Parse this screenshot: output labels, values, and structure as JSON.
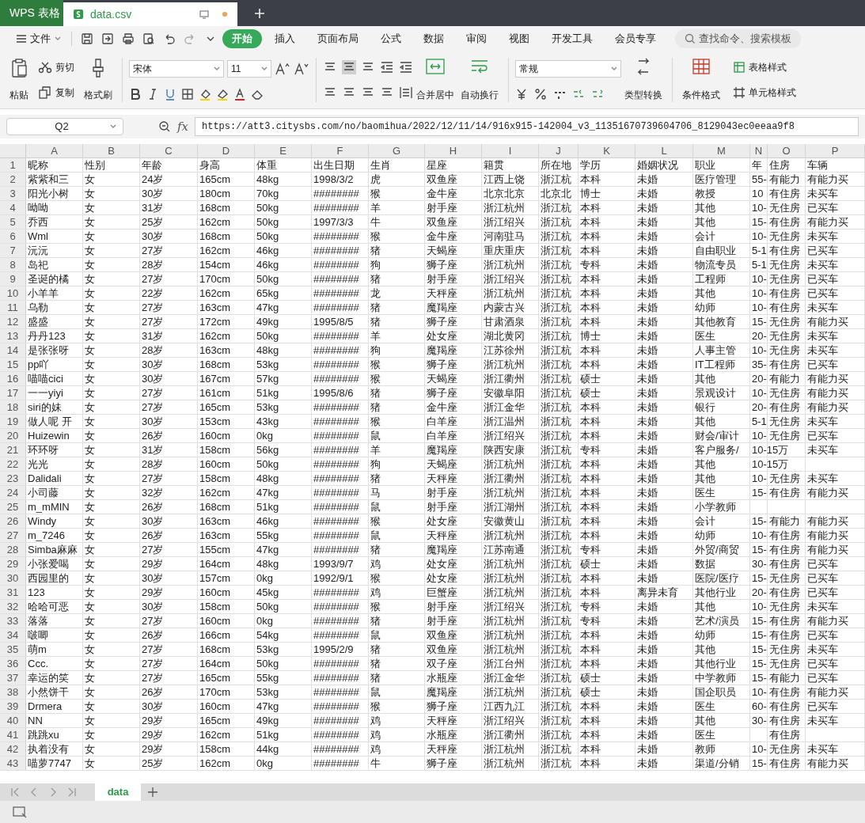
{
  "title_bar": {
    "tabs": [
      {
        "label": "WPS 表格",
        "kind": "app",
        "selected": false
      },
      {
        "label": "data.csv",
        "kind": "file",
        "selected": true
      }
    ]
  },
  "menu": {
    "file": "文件",
    "tabs": [
      {
        "label": "开始",
        "selected": true
      },
      {
        "label": "插入",
        "selected": false
      },
      {
        "label": "页面布局",
        "selected": false
      },
      {
        "label": "公式",
        "selected": false
      },
      {
        "label": "数据",
        "selected": false
      },
      {
        "label": "审阅",
        "selected": false
      },
      {
        "label": "视图",
        "selected": false
      },
      {
        "label": "开发工具",
        "selected": false
      },
      {
        "label": "会员专享",
        "selected": false
      }
    ],
    "search_placeholder": "查找命令、搜索模板"
  },
  "ribbon": {
    "paste": "粘贴",
    "cut": "剪切",
    "copy": "复制",
    "format_painter": "格式刷",
    "font": "宋体",
    "font_size": "11",
    "merge": "合并居中",
    "wrap": "自动换行",
    "number_format": "常规",
    "convert": "类型转换",
    "conditional": "条件格式",
    "table_style": "表格样式",
    "cell_style": "单元格样式"
  },
  "formula_bar": {
    "cell": "Q2",
    "function_label": "fx",
    "formula": "https://att3.citysbs.com/no/baomihua/2022/12/11/14/916x915-142004_v3_11351670739604706_8129043ec0eeaa9f8"
  },
  "sheet": {
    "columns": [
      "A",
      "B",
      "C",
      "D",
      "E",
      "F",
      "G",
      "H",
      "I",
      "J",
      "K",
      "L",
      "M",
      "N",
      "O",
      "P"
    ],
    "rows": [
      {
        "number": "1",
        "cells": [
          "昵称",
          "性别",
          "年龄",
          "身高",
          "体重",
          "出生日期",
          "生肖",
          "星座",
          "籍贯",
          "所在地",
          "学历",
          "婚姻状况",
          "职业",
          "年",
          "住房",
          "车辆"
        ]
      },
      {
        "number": "2",
        "cells": [
          "紫紫和三",
          "女",
          "24岁",
          "165cm",
          "48kg",
          "1998/3/2",
          "虎",
          "双鱼座",
          "江西上饶",
          "浙江杭",
          "本科",
          "未婚",
          "医疗管理",
          "55-",
          "有能力",
          "有能力买"
        ]
      },
      {
        "number": "3",
        "cells": [
          "阳光小树",
          "女",
          "30岁",
          "180cm",
          "70kg",
          "########",
          "猴",
          "金牛座",
          "北京北京",
          "北京北",
          "博士",
          "未婚",
          "教授",
          "10",
          "有住房",
          "未买车"
        ]
      },
      {
        "number": "4",
        "cells": [
          "呦呦",
          "女",
          "31岁",
          "168cm",
          "50kg",
          "########",
          "羊",
          "射手座",
          "浙江杭州",
          "浙江杭",
          "本科",
          "未婚",
          "其他",
          "10-",
          "无住房",
          "已买车"
        ]
      },
      {
        "number": "5",
        "cells": [
          "乔西",
          "女",
          "25岁",
          "162cm",
          "50kg",
          "1997/3/3",
          "牛",
          "双鱼座",
          "浙江绍兴",
          "浙江杭",
          "本科",
          "未婚",
          "其他",
          "15-",
          "有住房",
          "有能力买"
        ]
      },
      {
        "number": "6",
        "cells": [
          "Wml",
          "女",
          "30岁",
          "168cm",
          "50kg",
          "########",
          "猴",
          "金牛座",
          "河南驻马",
          "浙江杭",
          "本科",
          "未婚",
          "会计",
          "10-",
          "无住房",
          "未买车"
        ]
      },
      {
        "number": "7",
        "cells": [
          "沅沅",
          "女",
          "27岁",
          "162cm",
          "46kg",
          "########",
          "猪",
          "天蝎座",
          "重庆重庆",
          "浙江杭",
          "本科",
          "未婚",
          "自由职业",
          "5-1",
          "有住房",
          "已买车"
        ]
      },
      {
        "number": "8",
        "cells": [
          "岛祀",
          "女",
          "28岁",
          "154cm",
          "46kg",
          "########",
          "狗",
          "狮子座",
          "浙江杭州",
          "浙江杭",
          "专科",
          "未婚",
          "物流专员",
          "5-1",
          "无住房",
          "未买车"
        ]
      },
      {
        "number": "9",
        "cells": [
          "圣诞的橘",
          "女",
          "27岁",
          "170cm",
          "50kg",
          "########",
          "猪",
          "射手座",
          "浙江绍兴",
          "浙江杭",
          "本科",
          "未婚",
          "工程师",
          "10-",
          "无住房",
          "已买车"
        ]
      },
      {
        "number": "10",
        "cells": [
          "小羊羊",
          "女",
          "22岁",
          "162cm",
          "65kg",
          "########",
          "龙",
          "天秤座",
          "浙江杭州",
          "浙江杭",
          "本科",
          "未婚",
          "其他",
          "10-",
          "有住房",
          "已买车"
        ]
      },
      {
        "number": "11",
        "cells": [
          "乌勒",
          "女",
          "27岁",
          "163cm",
          "47kg",
          "########",
          "猪",
          "魔羯座",
          "内蒙古兴",
          "浙江杭",
          "本科",
          "未婚",
          "幼师",
          "10-",
          "有住房",
          "未买车"
        ]
      },
      {
        "number": "12",
        "cells": [
          "盛盛",
          "女",
          "27岁",
          "172cm",
          "49kg",
          "1995/8/5",
          "猪",
          "狮子座",
          "甘肃酒泉",
          "浙江杭",
          "本科",
          "未婚",
          "其他教育",
          "15-",
          "无住房",
          "有能力买"
        ]
      },
      {
        "number": "13",
        "cells": [
          "丹丹123",
          "女",
          "31岁",
          "162cm",
          "50kg",
          "########",
          "羊",
          "处女座",
          "湖北黄冈",
          "浙江杭",
          "博士",
          "未婚",
          "医生",
          "20-",
          "无住房",
          "未买车"
        ]
      },
      {
        "number": "14",
        "cells": [
          "是张张呀",
          "女",
          "28岁",
          "163cm",
          "48kg",
          "########",
          "狗",
          "魔羯座",
          "江苏徐州",
          "浙江杭",
          "本科",
          "未婚",
          "人事主管",
          "10-",
          "无住房",
          "未买车"
        ]
      },
      {
        "number": "15",
        "cells": [
          "pp吖",
          "女",
          "30岁",
          "168cm",
          "53kg",
          "########",
          "猴",
          "狮子座",
          "浙江杭州",
          "浙江杭",
          "本科",
          "未婚",
          "IT工程师",
          "35-",
          "有住房",
          "已买车"
        ]
      },
      {
        "number": "16",
        "cells": [
          "喵喵cici",
          "女",
          "30岁",
          "167cm",
          "57kg",
          "########",
          "猴",
          "天蝎座",
          "浙江衢州",
          "浙江杭",
          "硕士",
          "未婚",
          "其他",
          "20-",
          "有能力",
          "有能力买"
        ]
      },
      {
        "number": "17",
        "cells": [
          "一一yiyi",
          "女",
          "27岁",
          "161cm",
          "51kg",
          "1995/8/6",
          "猪",
          "狮子座",
          "安徽阜阳",
          "浙江杭",
          "硕士",
          "未婚",
          "景观设计",
          "10-",
          "无住房",
          "有能力买"
        ]
      },
      {
        "number": "18",
        "cells": [
          "siri的妹",
          "女",
          "27岁",
          "165cm",
          "53kg",
          "########",
          "猪",
          "金牛座",
          "浙江金华",
          "浙江杭",
          "本科",
          "未婚",
          "银行",
          "20-",
          "有住房",
          "有能力买"
        ]
      },
      {
        "number": "19",
        "cells": [
          "做人呢 开",
          "女",
          "30岁",
          "153cm",
          "43kg",
          "########",
          "猴",
          "白羊座",
          "浙江温州",
          "浙江杭",
          "本科",
          "未婚",
          "其他",
          "5-1",
          "无住房",
          "未买车"
        ]
      },
      {
        "number": "20",
        "cells": [
          "Huizewin",
          "女",
          "26岁",
          "160cm",
          "0kg",
          "########",
          "鼠",
          "白羊座",
          "浙江绍兴",
          "浙江杭",
          "本科",
          "未婚",
          "财会/审计",
          "10-",
          "无住房",
          "已买车"
        ]
      },
      {
        "number": "21",
        "cells": [
          "环环呀",
          "女",
          "31岁",
          "158cm",
          "56kg",
          "########",
          "羊",
          "魔羯座",
          "陕西安康",
          "浙江杭",
          "专科",
          "未婚",
          "客户服务/",
          "10-15万",
          "",
          "未买车"
        ]
      },
      {
        "number": "22",
        "cells": [
          "光光",
          "女",
          "28岁",
          "160cm",
          "50kg",
          "########",
          "狗",
          "天蝎座",
          "浙江杭州",
          "浙江杭",
          "本科",
          "未婚",
          "其他",
          "10-15万",
          "",
          ""
        ]
      },
      {
        "number": "23",
        "cells": [
          "Dalidali",
          "女",
          "27岁",
          "158cm",
          "48kg",
          "########",
          "猪",
          "天秤座",
          "浙江衢州",
          "浙江杭",
          "本科",
          "未婚",
          "其他",
          "10-",
          "无住房",
          "未买车"
        ]
      },
      {
        "number": "24",
        "cells": [
          "小司藤",
          "女",
          "32岁",
          "162cm",
          "47kg",
          "########",
          "马",
          "射手座",
          "浙江杭州",
          "浙江杭",
          "本科",
          "未婚",
          "医生",
          "15-",
          "有住房",
          "有能力买"
        ]
      },
      {
        "number": "25",
        "cells": [
          "m_mMIN",
          "女",
          "26岁",
          "168cm",
          "51kg",
          "########",
          "鼠",
          "射手座",
          "浙江湖州",
          "浙江杭",
          "本科",
          "未婚",
          "小学教师",
          "",
          "",
          ""
        ]
      },
      {
        "number": "26",
        "cells": [
          "Windy",
          "女",
          "30岁",
          "163cm",
          "46kg",
          "########",
          "猴",
          "处女座",
          "安徽黄山",
          "浙江杭",
          "本科",
          "未婚",
          "会计",
          "15-",
          "有能力",
          "有能力买"
        ]
      },
      {
        "number": "27",
        "cells": [
          "m_7246",
          "女",
          "26岁",
          "163cm",
          "55kg",
          "########",
          "鼠",
          "天秤座",
          "浙江杭州",
          "浙江杭",
          "本科",
          "未婚",
          "幼师",
          "10-",
          "有住房",
          "有能力买"
        ]
      },
      {
        "number": "28",
        "cells": [
          "Simba麻麻",
          "女",
          "27岁",
          "155cm",
          "47kg",
          "########",
          "猪",
          "魔羯座",
          "江苏南通",
          "浙江杭",
          "专科",
          "未婚",
          "外贸/商贸",
          "15-",
          "有住房",
          "有能力买"
        ]
      },
      {
        "number": "29",
        "cells": [
          "小张爱喝",
          "女",
          "29岁",
          "164cm",
          "48kg",
          "1993/9/7",
          "鸡",
          "处女座",
          "浙江杭州",
          "浙江杭",
          "硕士",
          "未婚",
          "数据",
          "30-",
          "有住房",
          "已买车"
        ]
      },
      {
        "number": "30",
        "cells": [
          "西园里的",
          "女",
          "30岁",
          "157cm",
          "0kg",
          "1992/9/1",
          "猴",
          "处女座",
          "浙江杭州",
          "浙江杭",
          "本科",
          "未婚",
          "医院/医疗",
          "15-",
          "无住房",
          "已买车"
        ]
      },
      {
        "number": "31",
        "cells": [
          "123",
          "女",
          "29岁",
          "160cm",
          "45kg",
          "########",
          "鸡",
          "巨蟹座",
          "浙江杭州",
          "浙江杭",
          "本科",
          "离异未育",
          "其他行业",
          "20-",
          "有住房",
          "已买车"
        ]
      },
      {
        "number": "32",
        "cells": [
          "哈哈可恶",
          "女",
          "30岁",
          "158cm",
          "50kg",
          "########",
          "猴",
          "射手座",
          "浙江绍兴",
          "浙江杭",
          "专科",
          "未婚",
          "其他",
          "10-",
          "无住房",
          "未买车"
        ]
      },
      {
        "number": "33",
        "cells": [
          "落落",
          "女",
          "27岁",
          "160cm",
          "0kg",
          "########",
          "猪",
          "射手座",
          "浙江杭州",
          "浙江杭",
          "专科",
          "未婚",
          "艺术/演员",
          "15-",
          "有住房",
          "有能力买"
        ]
      },
      {
        "number": "34",
        "cells": [
          "啵唧",
          "女",
          "26岁",
          "166cm",
          "54kg",
          "########",
          "鼠",
          "双鱼座",
          "浙江杭州",
          "浙江杭",
          "本科",
          "未婚",
          "幼师",
          "15-",
          "有住房",
          "已买车"
        ]
      },
      {
        "number": "35",
        "cells": [
          "萌m",
          "女",
          "27岁",
          "168cm",
          "53kg",
          "1995/2/9",
          "猪",
          "双鱼座",
          "浙江杭州",
          "浙江杭",
          "本科",
          "未婚",
          "其他",
          "15-",
          "无住房",
          "未买车"
        ]
      },
      {
        "number": "36",
        "cells": [
          "Ccc.",
          "女",
          "27岁",
          "164cm",
          "50kg",
          "########",
          "猪",
          "双子座",
          "浙江台州",
          "浙江杭",
          "本科",
          "未婚",
          "其他行业",
          "15-",
          "无住房",
          "已买车"
        ]
      },
      {
        "number": "37",
        "cells": [
          "幸运的笑",
          "女",
          "27岁",
          "165cm",
          "55kg",
          "########",
          "猪",
          "水瓶座",
          "浙江金华",
          "浙江杭",
          "硕士",
          "未婚",
          "中学教师",
          "15-",
          "有能力",
          "已买车"
        ]
      },
      {
        "number": "38",
        "cells": [
          "小然饼干",
          "女",
          "26岁",
          "170cm",
          "53kg",
          "########",
          "鼠",
          "魔羯座",
          "浙江杭州",
          "浙江杭",
          "硕士",
          "未婚",
          "国企职员",
          "10-",
          "有住房",
          "有能力买"
        ]
      },
      {
        "number": "39",
        "cells": [
          "Drmera",
          "女",
          "30岁",
          "160cm",
          "47kg",
          "########",
          "猴",
          "狮子座",
          "江西九江",
          "浙江杭",
          "本科",
          "未婚",
          "医生",
          "60-",
          "有住房",
          "已买车"
        ]
      },
      {
        "number": "40",
        "cells": [
          "NN",
          "女",
          "29岁",
          "165cm",
          "49kg",
          "########",
          "鸡",
          "天秤座",
          "浙江绍兴",
          "浙江杭",
          "本科",
          "未婚",
          "其他",
          "30-",
          "有住房",
          "未买车"
        ]
      },
      {
        "number": "41",
        "cells": [
          "跳跳xu",
          "女",
          "29岁",
          "162cm",
          "51kg",
          "########",
          "鸡",
          "水瓶座",
          "浙江衢州",
          "浙江杭",
          "本科",
          "未婚",
          "医生",
          "",
          "有住房",
          ""
        ]
      },
      {
        "number": "42",
        "cells": [
          "执着没有",
          "女",
          "29岁",
          "158cm",
          "44kg",
          "########",
          "鸡",
          "天秤座",
          "浙江杭州",
          "浙江杭",
          "本科",
          "未婚",
          "教师",
          "10-",
          "无住房",
          "未买车"
        ]
      },
      {
        "number": "43",
        "cells": [
          "喵萝7747",
          "女",
          "25岁",
          "162cm",
          "0kg",
          "########",
          "牛",
          "狮子座",
          "浙江杭州",
          "浙江杭",
          "本科",
          "未婚",
          "渠道/分销",
          "15-",
          "有住房",
          "有能力买"
        ]
      }
    ]
  },
  "sheet_tabs": [
    {
      "label": "data",
      "selected": true
    }
  ]
}
